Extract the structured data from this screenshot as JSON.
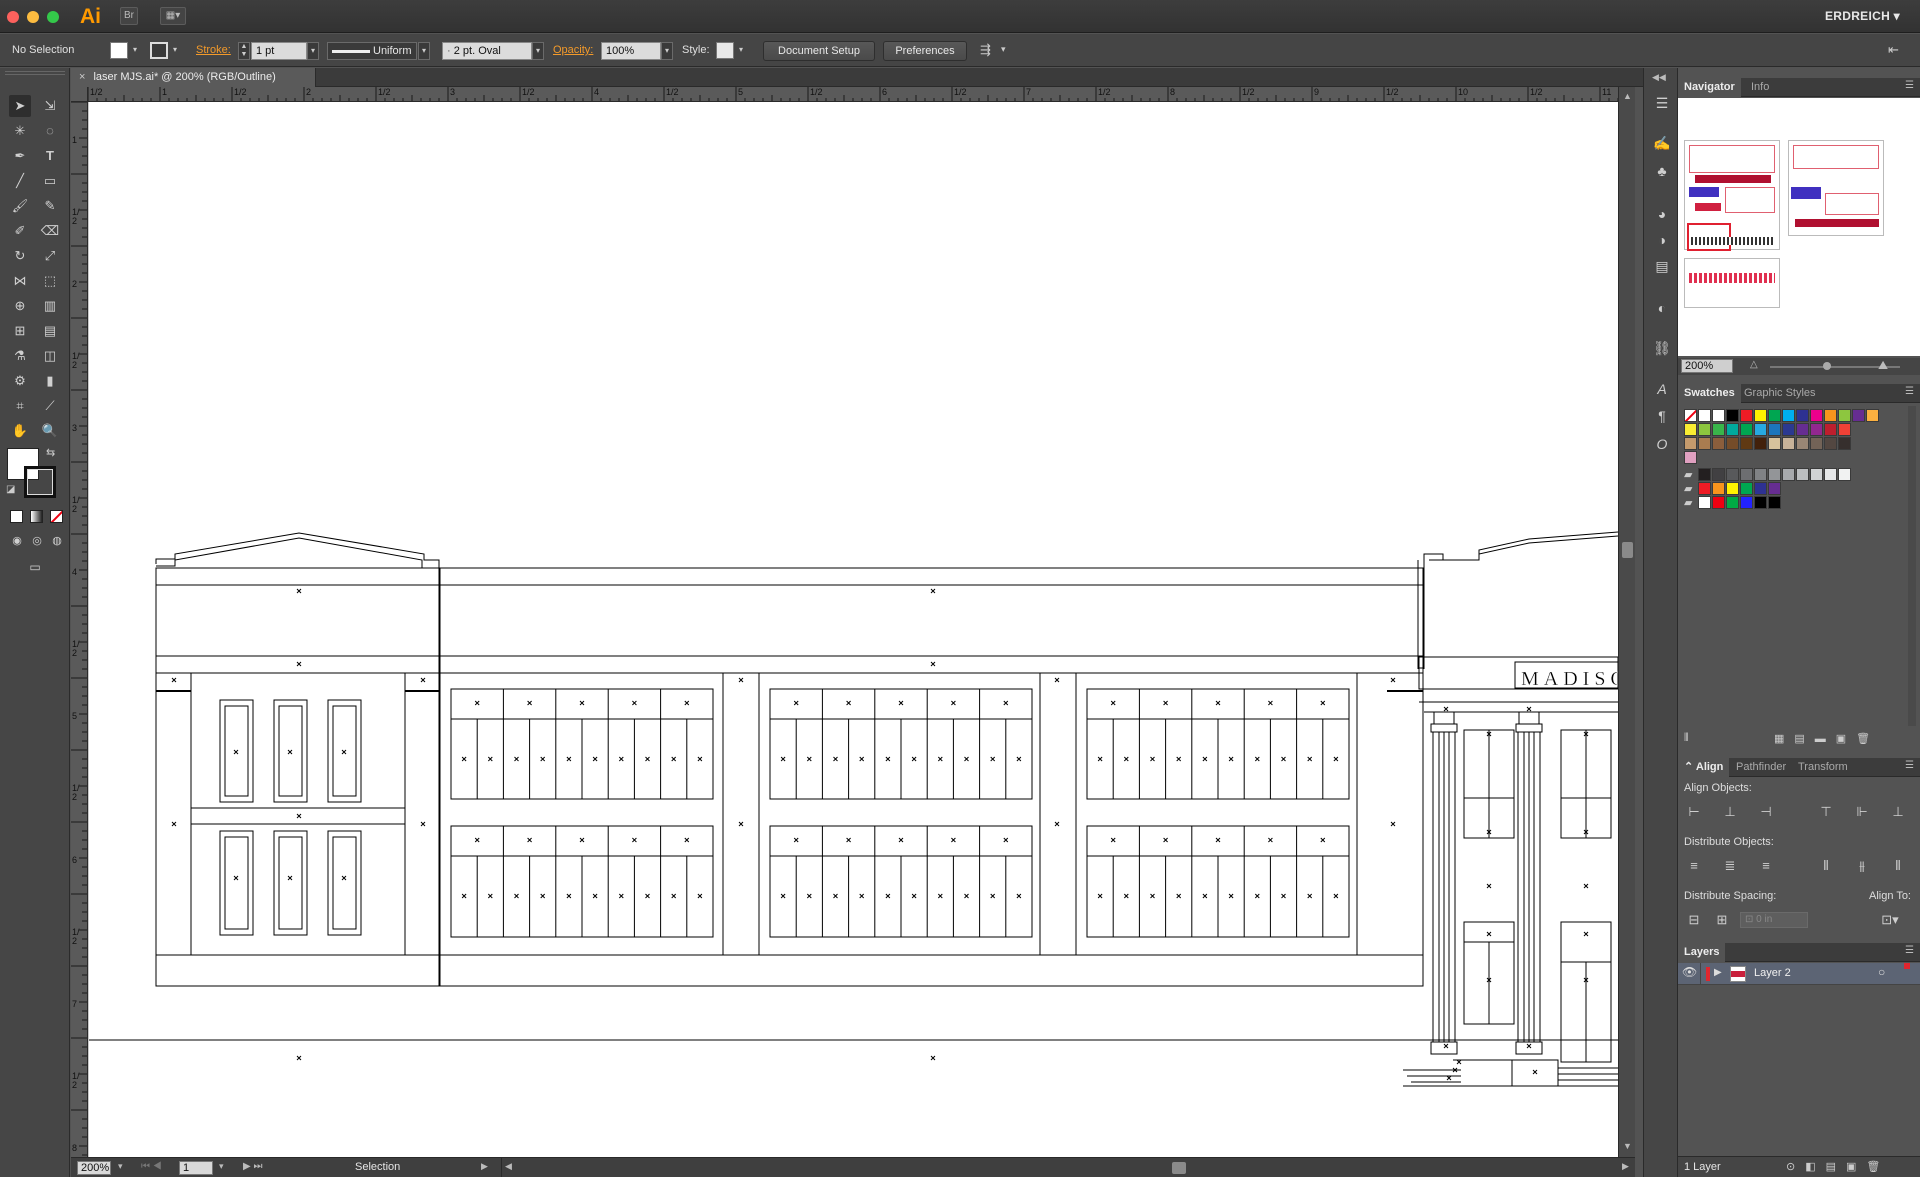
{
  "app": {
    "logo": "Ai",
    "bridge_label": "Br",
    "workspace": "ERDREICH ▾"
  },
  "control": {
    "selection": "No Selection",
    "stroke_label": "Stroke:",
    "stroke_weight": "1 pt",
    "stroke_profile": "Uniform",
    "brush": "2 pt. Oval",
    "opacity_label": "Opacity:",
    "opacity": "100%",
    "style_label": "Style:",
    "document_setup": "Document Setup",
    "preferences": "Preferences"
  },
  "document": {
    "tab_title": "laser MJS.ai* @ 200% (RGB/Outline)",
    "hruler_ticks": [
      "1/2",
      "1",
      "1/2",
      "2",
      "1/2",
      "3",
      "1/2",
      "4",
      "1/2",
      "5",
      "1/2",
      "6",
      "1/2",
      "7",
      "1/2",
      "8",
      "1/2",
      "9",
      "1/2",
      "10",
      "1/2",
      "11"
    ],
    "vruler_ticks": [
      "1",
      "1/2",
      "2",
      "1/2",
      "3",
      "1/2",
      "4",
      "1/2",
      "5",
      "1/2",
      "6",
      "1/2",
      "7",
      "1/2",
      "8"
    ],
    "sign_text": "MADISO"
  },
  "status": {
    "zoom": "200%",
    "artboard": "1",
    "tool": "Selection"
  },
  "panels": {
    "navigator": {
      "tabs": [
        "Navigator",
        "Info"
      ],
      "zoom": "200%"
    },
    "swatches": {
      "tabs": [
        "Swatches",
        "Graphic Styles"
      ]
    },
    "align": {
      "tabs": [
        "Align",
        "Pathfinder",
        "Transform"
      ],
      "align_objects": "Align Objects:",
      "distribute_objects": "Distribute Objects:",
      "distribute_spacing": "Distribute Spacing:",
      "align_to": "Align To:",
      "spacing_value": "0 in"
    },
    "layers": {
      "title": "Layers",
      "layer_name": "Layer 2",
      "count": "1 Layer",
      "layer_color": "#e0262f"
    }
  },
  "colors": {
    "accent": "#ff9a00",
    "link": "#f39a2a",
    "swatch_row1": [
      "#ffffff",
      "#000000",
      "#ee1c25",
      "#fff200",
      "#00a651",
      "#00aeef",
      "#2e3192",
      "#ec008c",
      "#f7941d",
      "#8dc63f",
      "#662d91",
      "#fbb040"
    ],
    "swatch_row2": [
      "#f9ed32",
      "#8cc63f",
      "#39b54a",
      "#00a99d",
      "#00a651",
      "#27aae1",
      "#1c75bc",
      "#2b3990",
      "#662d91",
      "#92278f",
      "#be1e2d",
      "#ef4136"
    ],
    "swatch_row3": [
      "#c49a6c",
      "#a97c50",
      "#8b5e3c",
      "#754c29",
      "#603913",
      "#42210b",
      "#d7c29c",
      "#c7b299",
      "#998675",
      "#736357",
      "#534741",
      "#362f2d"
    ],
    "grays": [
      "#231f20",
      "#414042",
      "#58595b",
      "#6d6e71",
      "#808285",
      "#939598",
      "#a7a9ac",
      "#bcbec0",
      "#d1d3d4",
      "#e6e7e8",
      "#f1f2f2"
    ],
    "group2": [
      "#ee1c25",
      "#f7941d",
      "#fff200",
      "#00a651",
      "#2e3192",
      "#662d91"
    ]
  }
}
